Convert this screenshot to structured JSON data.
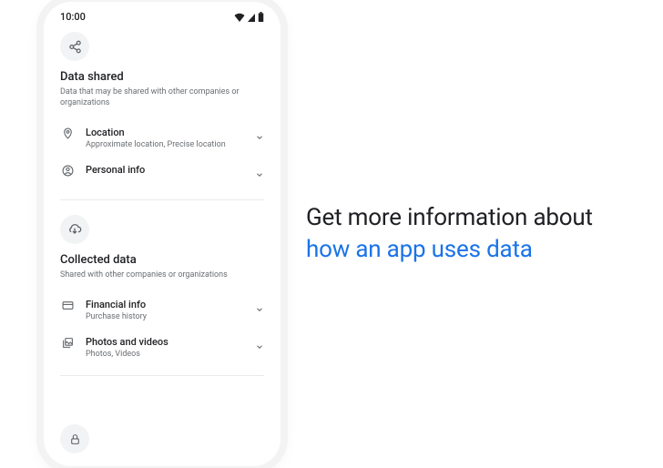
{
  "status": {
    "time": "10:00"
  },
  "headline": {
    "line1": "Get more information about",
    "line2": "how an app uses data"
  },
  "sections": {
    "shared": {
      "title": "Data shared",
      "subtitle": "Data that may be shared with other companies or organizations",
      "items": [
        {
          "title": "Location",
          "subtitle": "Approximate location, Precise location"
        },
        {
          "title": "Personal info",
          "subtitle": ""
        }
      ]
    },
    "collected": {
      "title": "Collected data",
      "subtitle": "Shared with other companies or organizations",
      "items": [
        {
          "title": "Financial info",
          "subtitle": "Purchase history"
        },
        {
          "title": "Photos and videos",
          "subtitle": "Photos, Videos"
        }
      ]
    }
  }
}
